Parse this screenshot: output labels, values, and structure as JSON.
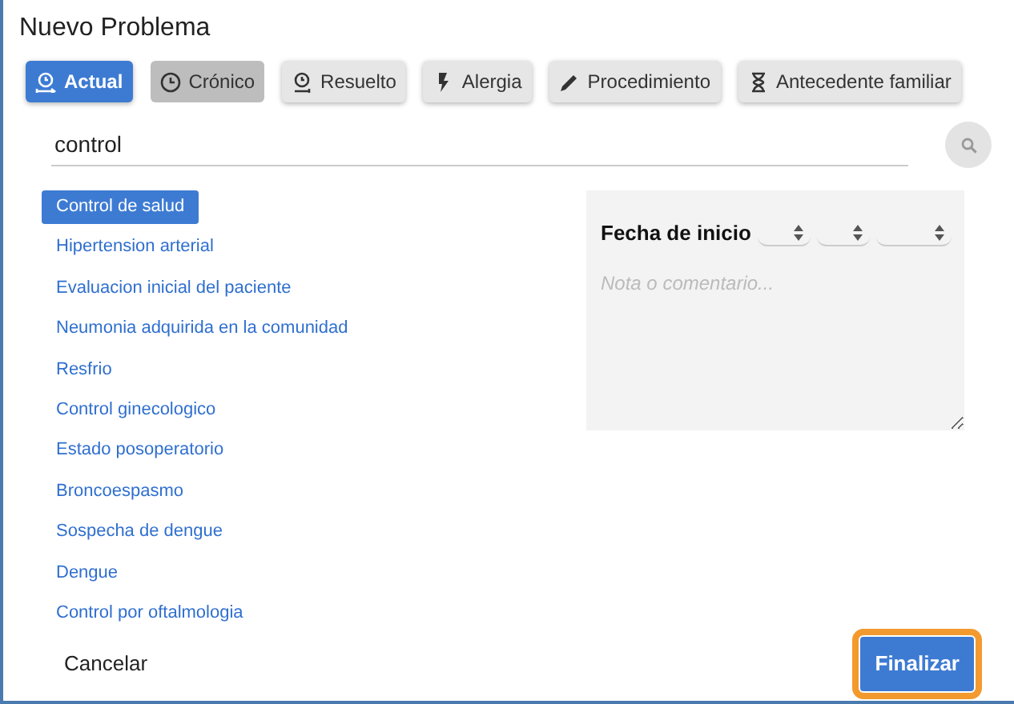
{
  "dialog": {
    "title": "Nuevo Problema"
  },
  "types": [
    {
      "label": "Actual",
      "kind": "current",
      "selected": true,
      "pressed": false
    },
    {
      "label": "Crónico",
      "kind": "chronic",
      "selected": false,
      "pressed": true
    },
    {
      "label": "Resuelto",
      "kind": "resolved",
      "selected": false,
      "pressed": false
    },
    {
      "label": "Alergia",
      "kind": "allergy",
      "selected": false,
      "pressed": false
    },
    {
      "label": "Procedimiento",
      "kind": "procedure",
      "selected": false,
      "pressed": false
    },
    {
      "label": "Antecedente familiar",
      "kind": "family",
      "selected": false,
      "pressed": false
    }
  ],
  "search": {
    "value": "control"
  },
  "results": [
    {
      "label": "Control de salud",
      "selected": true
    },
    {
      "label": "Hipertension arterial",
      "selected": false
    },
    {
      "label": "Evaluacion inicial del paciente",
      "selected": false
    },
    {
      "label": "Neumonia adquirida en la comunidad",
      "selected": false
    },
    {
      "label": "Resfrio",
      "selected": false
    },
    {
      "label": "Control ginecologico",
      "selected": false
    },
    {
      "label": "Estado posoperatorio",
      "selected": false
    },
    {
      "label": "Broncoespasmo",
      "selected": false
    },
    {
      "label": "Sospecha de dengue",
      "selected": false
    },
    {
      "label": "Dengue",
      "selected": false
    },
    {
      "label": "Control por oftalmologia",
      "selected": false
    }
  ],
  "details": {
    "start_date_label": "Fecha de inicio",
    "note": {
      "placeholder": "Nota o comentario..."
    }
  },
  "footer": {
    "cancel": "Cancelar",
    "finish": {
      "label": "Finalizar",
      "focused": true
    }
  }
}
